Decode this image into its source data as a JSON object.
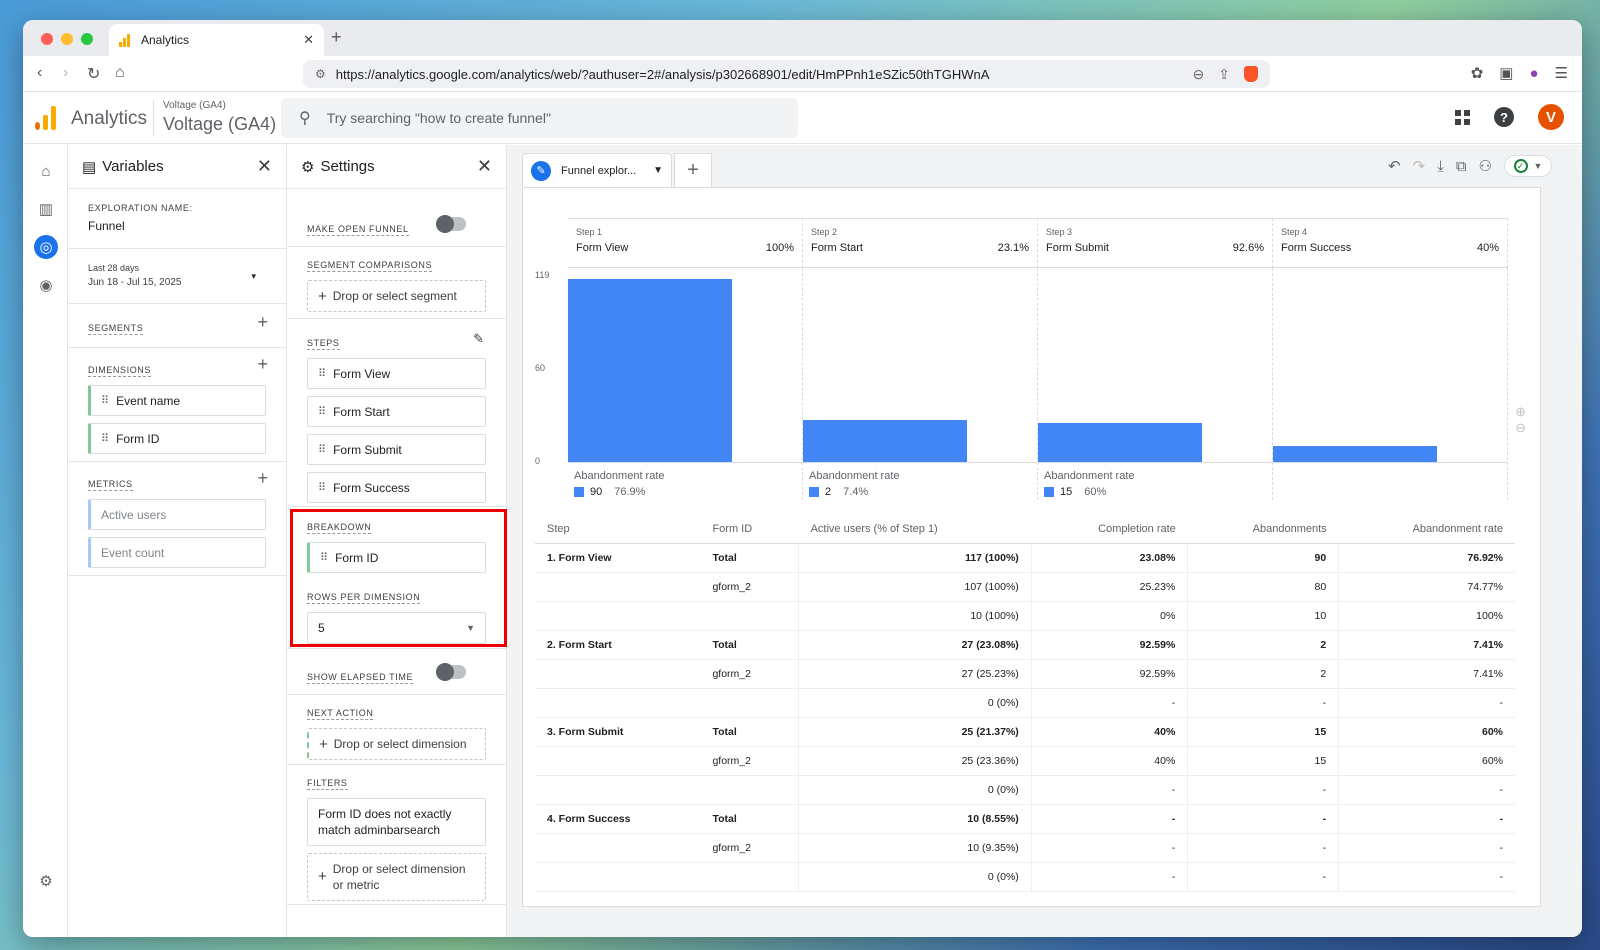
{
  "browser": {
    "tab_title": "Analytics",
    "url": "https://analytics.google.com/analytics/web/?authuser=2#/analysis/p302668901/edit/HmPPnh1eSZic50thTGHWnA"
  },
  "header": {
    "app_name": "Analytics",
    "property_sub": "Voltage (GA4)",
    "property_name": "Voltage (GA4)",
    "search_placeholder": "Try searching \"how to create funnel\"",
    "avatar_letter": "V"
  },
  "variables": {
    "title": "Variables",
    "exploration_label": "EXPLORATION NAME:",
    "exploration_name": "Funnel",
    "date_label": "Last 28 days",
    "date_range": "Jun 18 - Jul 15, 2025",
    "segments_label": "SEGMENTS",
    "dimensions_label": "DIMENSIONS",
    "dimensions": [
      "Event name",
      "Form ID"
    ],
    "metrics_label": "METRICS",
    "metrics": [
      "Active users",
      "Event count"
    ]
  },
  "settings": {
    "title": "Settings",
    "open_funnel_label": "MAKE OPEN FUNNEL",
    "segment_comp_label": "SEGMENT COMPARISONS",
    "segment_drop": "Drop or select segment",
    "steps_label": "STEPS",
    "steps": [
      "Form View",
      "Form Start",
      "Form Submit",
      "Form Success"
    ],
    "breakdown_label": "BREAKDOWN",
    "breakdown_value": "Form ID",
    "rows_label": "ROWS PER DIMENSION",
    "rows_value": "5",
    "elapsed_label": "SHOW ELAPSED TIME",
    "next_action_label": "NEXT ACTION",
    "next_action_drop": "Drop or select dimension",
    "filters_label": "FILTERS",
    "filter_value": "Form ID does not exactly match adminbarsearch",
    "filter_drop": "Drop or select dimension or metric"
  },
  "exploration": {
    "tab_label": "Funnel explor...",
    "status_color": "#188038"
  },
  "chart_data": {
    "type": "bar",
    "categories": [
      "Form View",
      "Form Start",
      "Form Submit",
      "Form Success"
    ],
    "step_numbers": [
      "Step 1",
      "Step 2",
      "Step 3",
      "Step 4"
    ],
    "step_pcts": [
      "100%",
      "23.1%",
      "92.6%",
      "40%"
    ],
    "values": [
      117,
      27,
      25,
      10
    ],
    "y_ticks": [
      "119",
      "60",
      "0"
    ],
    "ylim": [
      0,
      119
    ],
    "abandonment_label": "Abandonment rate",
    "abandonments": [
      {
        "count": "90",
        "rate": "76.9%"
      },
      {
        "count": "2",
        "rate": "7.4%"
      },
      {
        "count": "15",
        "rate": "60%"
      }
    ],
    "bar_color": "#4285f4"
  },
  "table": {
    "headers": [
      "Step",
      "Form ID",
      "Active users (% of Step 1)",
      "Completion rate",
      "Abandonments",
      "Abandonment rate"
    ],
    "rows": [
      {
        "step": "1. Form View",
        "form": "Total",
        "users": "117 (100%)",
        "comp": "23.08%",
        "aband": "90",
        "rate": "76.92%",
        "total": true
      },
      {
        "step": "",
        "form": "gform_2",
        "users": "107 (100%)",
        "comp": "25.23%",
        "aband": "80",
        "rate": "74.77%"
      },
      {
        "step": "",
        "form": "",
        "users": "10 (100%)",
        "comp": "0%",
        "aband": "10",
        "rate": "100%"
      },
      {
        "step": "2. Form Start",
        "form": "Total",
        "users": "27 (23.08%)",
        "comp": "92.59%",
        "aband": "2",
        "rate": "7.41%",
        "total": true
      },
      {
        "step": "",
        "form": "gform_2",
        "users": "27 (25.23%)",
        "comp": "92.59%",
        "aband": "2",
        "rate": "7.41%"
      },
      {
        "step": "",
        "form": "",
        "users": "0 (0%)",
        "comp": "-",
        "aband": "-",
        "rate": "-"
      },
      {
        "step": "3. Form Submit",
        "form": "Total",
        "users": "25 (21.37%)",
        "comp": "40%",
        "aband": "15",
        "rate": "60%",
        "total": true
      },
      {
        "step": "",
        "form": "gform_2",
        "users": "25 (23.36%)",
        "comp": "40%",
        "aband": "15",
        "rate": "60%"
      },
      {
        "step": "",
        "form": "",
        "users": "0 (0%)",
        "comp": "-",
        "aband": "-",
        "rate": "-"
      },
      {
        "step": "4. Form Success",
        "form": "Total",
        "users": "10 (8.55%)",
        "comp": "-",
        "aband": "-",
        "rate": "-",
        "total": true
      },
      {
        "step": "",
        "form": "gform_2",
        "users": "10 (9.35%)",
        "comp": "-",
        "aband": "-",
        "rate": "-"
      },
      {
        "step": "",
        "form": "",
        "users": "0 (0%)",
        "comp": "-",
        "aband": "-",
        "rate": "-"
      }
    ]
  }
}
